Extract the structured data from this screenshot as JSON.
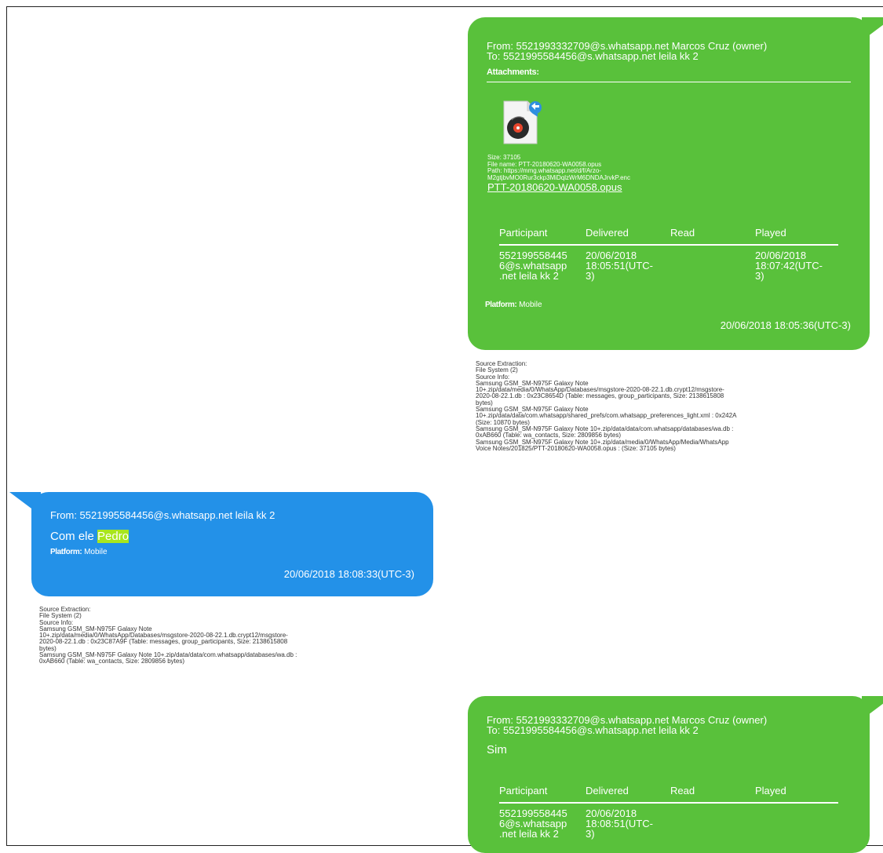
{
  "msg1": {
    "from_line": "From: 5521993332709@s.whatsapp.net Marcos Cruz (owner)",
    "to_line": "To: 5521995584456@s.whatsapp.net leila kk 2",
    "attachments_label": "Attachments:",
    "size_line": "Size: 37105",
    "file_name_line": "File name: PTT-20180620-WA0058.opus",
    "path_line1": "Path: https://mmg.whatsapp.net/d/f/Arzo-",
    "path_line2": "M2gtjbvMO0Rur3ckp3MiDqlzWrM6DNDAJrvkP.enc",
    "file_link": "PTT-20180620-WA0058.opus",
    "table_headers": [
      "Participant",
      "Delivered",
      "Read",
      "Played"
    ],
    "row": {
      "participant": [
        "552199558445",
        "6@s.whatsapp",
        ".net leila kk 2"
      ],
      "delivered": [
        "20/06/2018",
        "18:05:51(UTC-",
        "3)"
      ],
      "read": "",
      "played": [
        "20/06/2018",
        "18:07:42(UTC-",
        "3)"
      ]
    },
    "platform_label": "Platform:",
    "platform_value": "Mobile",
    "timestamp": "20/06/2018 18:05:36(UTC-3)",
    "source_lines": [
      "Source Extraction:",
      "File System (2)",
      "Source Info:",
      "Samsung GSM_SM-N975F Galaxy Note",
      "10+.zip/data/media/0/WhatsApp/Databases/msgstore-2020-08-22.1.db.crypt12/msgstore-",
      "2020-08-22.1.db : 0x23C8654D (Table: messages, group_participants, Size: 2138615808",
      "bytes)",
      "Samsung GSM_SM-N975F Galaxy Note",
      "10+.zip/data/data/com.whatsapp/shared_prefs/com.whatsapp_preferences_light.xml : 0x242A",
      "(Size: 10870 bytes)",
      "Samsung GSM_SM-N975F Galaxy Note 10+.zip/data/data/com.whatsapp/databases/wa.db :",
      "0xAB660 (Table: wa_contacts, Size: 2809856 bytes)",
      "Samsung GSM_SM-N975F Galaxy Note 10+.zip/data/media/0/WhatsApp/Media/WhatsApp",
      "Voice Notes/201825/PTT-20180620-WA0058.opus :  (Size: 37105 bytes)"
    ]
  },
  "msg2": {
    "from_line": "From: 5521995584456@s.whatsapp.net leila kk 2",
    "text_prefix": "Com ele ",
    "text_highlight": "Pedro",
    "platform_label": "Platform:",
    "platform_value": "Mobile",
    "timestamp": "20/06/2018 18:08:33(UTC-3)",
    "source_lines": [
      "Source Extraction:",
      "File System (2)",
      "Source Info:",
      "Samsung GSM_SM-N975F Galaxy Note",
      "10+.zip/data/media/0/WhatsApp/Databases/msgstore-2020-08-22.1.db.crypt12/msgstore-",
      "2020-08-22.1.db : 0x23C87A9F (Table: messages, group_participants, Size: 2138615808",
      "bytes)",
      "Samsung GSM_SM-N975F Galaxy Note 10+.zip/data/data/com.whatsapp/databases/wa.db :",
      "0xAB660 (Table: wa_contacts, Size: 2809856 bytes)"
    ]
  },
  "msg3": {
    "from_line": "From: 5521993332709@s.whatsapp.net Marcos Cruz (owner)",
    "to_line": "To: 5521995584456@s.whatsapp.net leila kk 2",
    "text": "Sim",
    "table_headers": [
      "Participant",
      "Delivered",
      "Read",
      "Played"
    ],
    "row": {
      "participant": [
        "552199558445",
        "6@s.whatsapp",
        ".net leila kk 2"
      ],
      "delivered": [
        "20/06/2018",
        "18:08:51(UTC-",
        "3)"
      ],
      "read": "",
      "played": ""
    }
  },
  "colors": {
    "outgoing_bubble": "#59c13b",
    "incoming_bubble": "#2391e8",
    "highlight": "#a8e61d"
  },
  "icons": {
    "audio_file": "audio-file-icon"
  }
}
